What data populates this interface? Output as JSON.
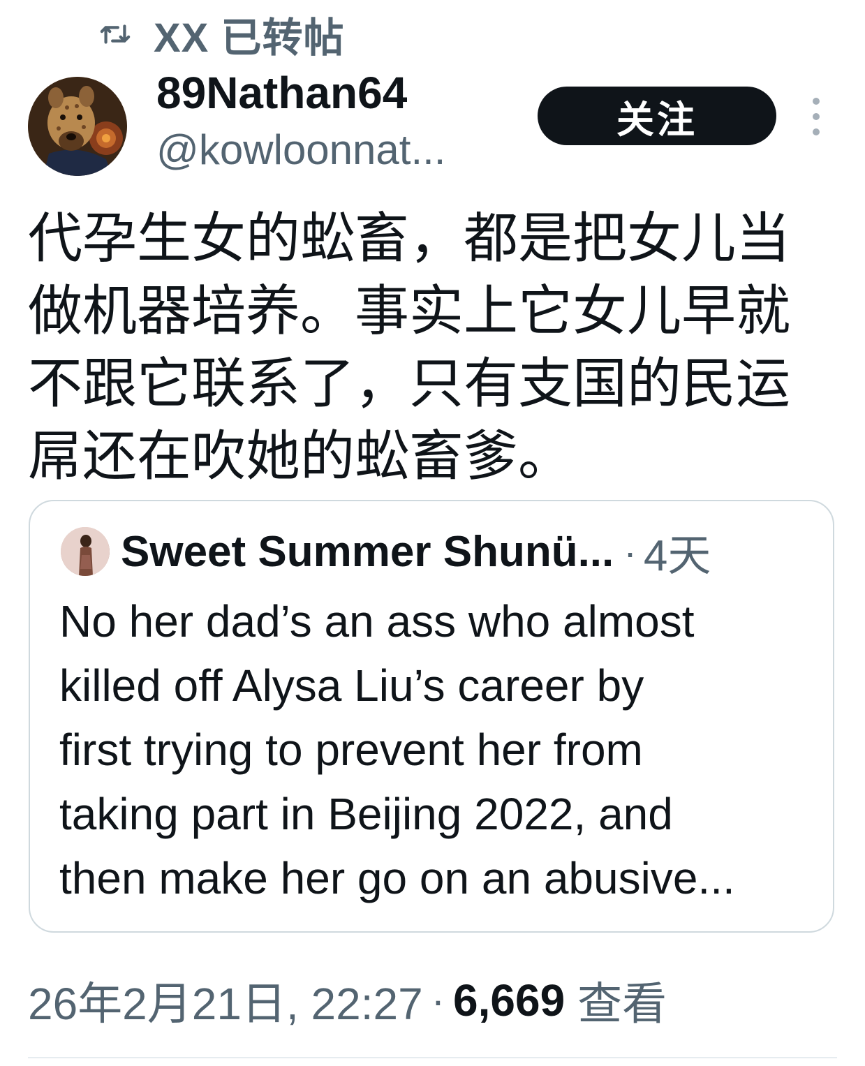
{
  "retweet_banner": {
    "icon": "retweet-icon",
    "text": "XX 已转帖"
  },
  "author": {
    "display_name": "89Nathan64",
    "handle": "@kowloonnat...",
    "avatar": "hyena-avatar"
  },
  "actions": {
    "follow_label": "关注",
    "more_icon": "more-vertical-icon"
  },
  "tweet": {
    "lines": [
      "代孕生女的蚣畜，都是把女儿当",
      "做机器培养。事实上它女儿早就",
      "不跟它联系了，只有支国的民运",
      "屌还在吹她的蚣畜爹。"
    ]
  },
  "quoted_tweet": {
    "name": "Sweet Summer Shunü...",
    "separator": "·",
    "time": "4天",
    "lines": [
      "No her dad’s an ass who almost",
      "killed off Alysa Liu’s career by",
      "first trying to prevent her from",
      "taking part in Beijing 2022, and",
      "then make her go on an abusive..."
    ]
  },
  "meta": {
    "timestamp": "26年2月21日, 22:27",
    "separator": "·",
    "views_count": "6,669",
    "views_label": "查看"
  },
  "colors": {
    "text_primary": "#0f1419",
    "text_secondary": "#536471",
    "border": "#cfd9de",
    "button_bg": "#0f1419"
  }
}
